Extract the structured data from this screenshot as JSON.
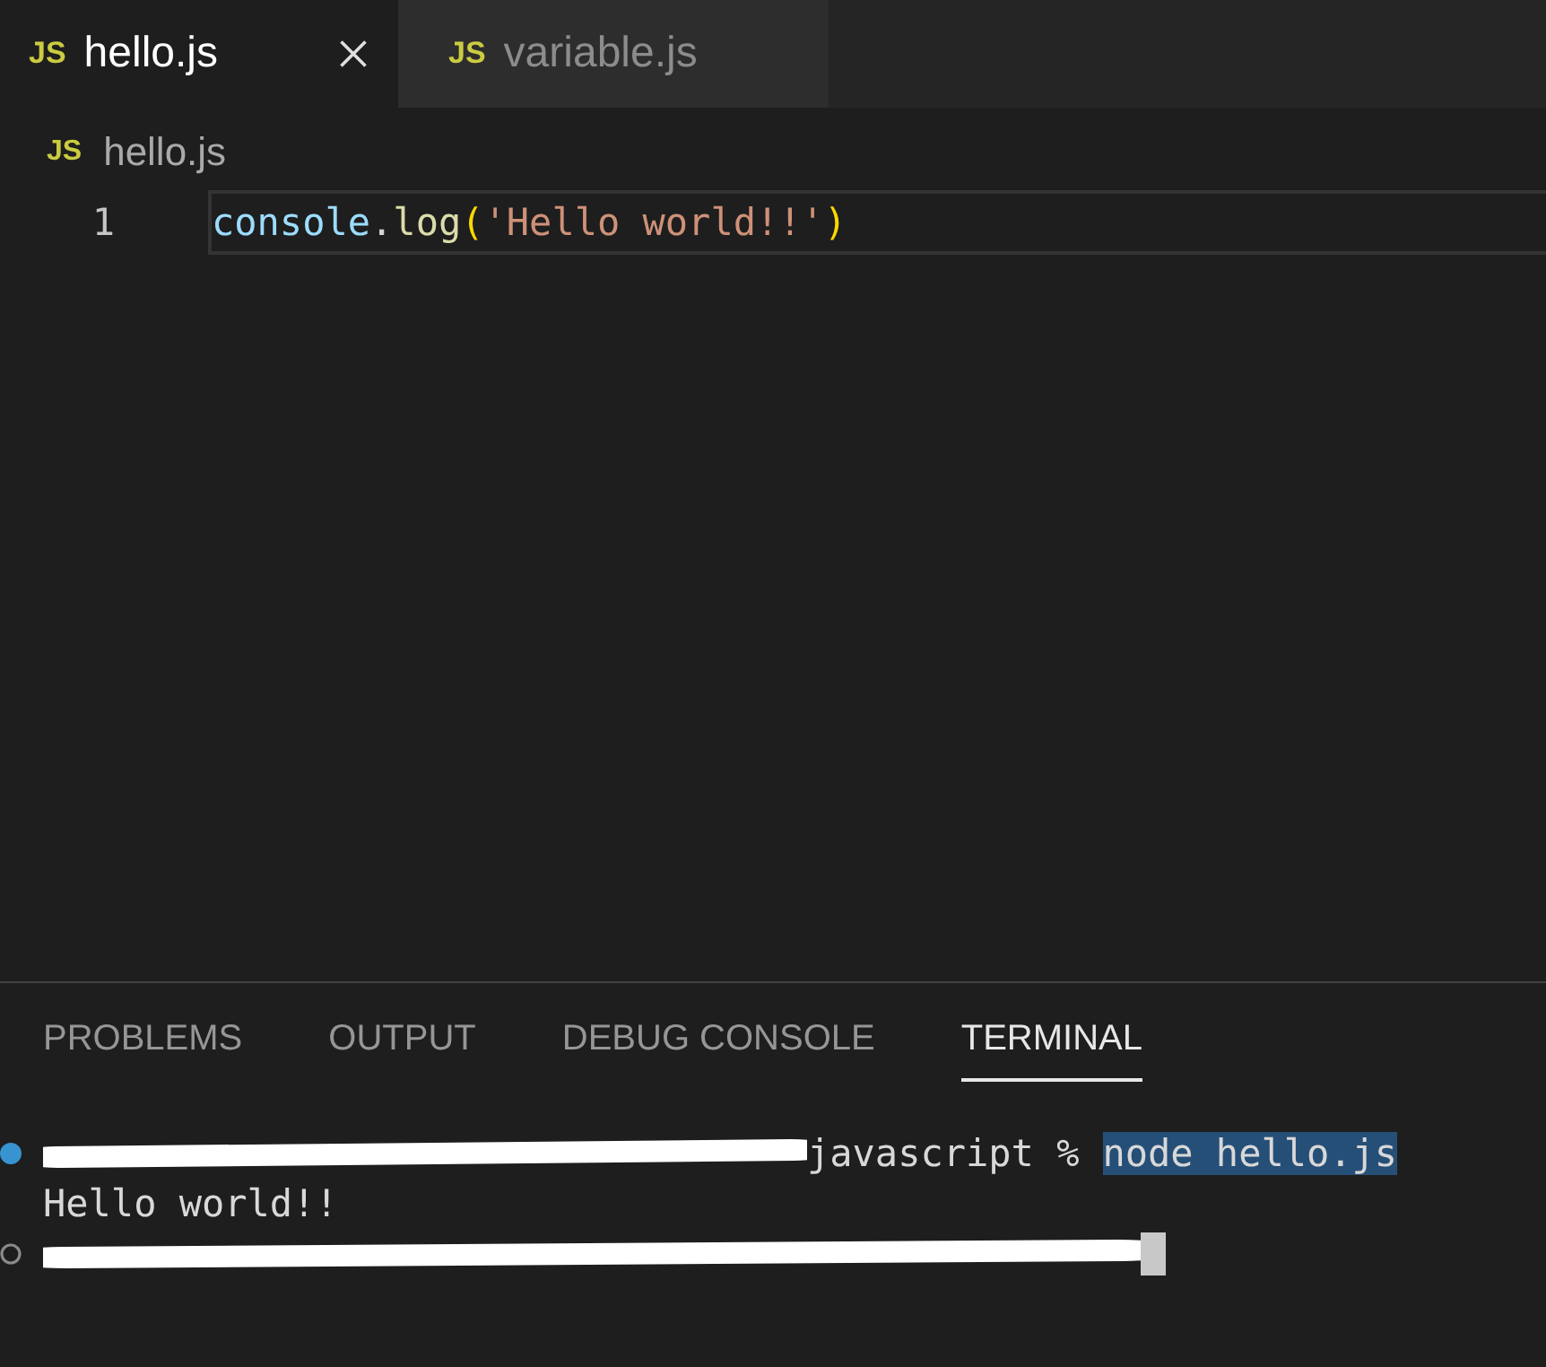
{
  "tabs": [
    {
      "label": "hello.js",
      "icon": "JS",
      "selected": true
    },
    {
      "label": "variable.js",
      "icon": "JS",
      "selected": false
    }
  ],
  "breadcrumb": {
    "icon": "JS",
    "label": "hello.js"
  },
  "editor": {
    "lines": [
      {
        "number": "1",
        "current": true,
        "tokens": [
          {
            "kind": "variable",
            "text": "console"
          },
          {
            "kind": "punct",
            "text": "."
          },
          {
            "kind": "function",
            "text": "log"
          },
          {
            "kind": "bracket",
            "text": "("
          },
          {
            "kind": "string",
            "text": "'Hello world!!'"
          },
          {
            "kind": "bracket",
            "text": ")"
          }
        ]
      }
    ]
  },
  "panel_tabs": [
    {
      "label": "PROBLEMS",
      "selected": false
    },
    {
      "label": "OUTPUT",
      "selected": false
    },
    {
      "label": "DEBUG CONSOLE",
      "selected": false
    },
    {
      "label": "TERMINAL",
      "selected": true
    }
  ],
  "terminal": [
    {
      "kind": "success",
      "segments": [
        {
          "kind": "redacted"
        },
        {
          "kind": "text",
          "text": "javascript %"
        },
        {
          "kind": "selected",
          "text": "node hello.js"
        }
      ]
    },
    {
      "kind": "output",
      "segments": [
        {
          "kind": "text",
          "text": "Hello world!!"
        }
      ]
    },
    {
      "kind": "idle",
      "segments": [
        {
          "kind": "redacted"
        },
        {
          "kind": "cursor"
        }
      ]
    }
  ]
}
